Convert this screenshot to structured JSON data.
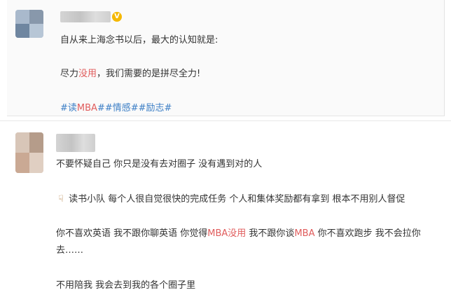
{
  "post": {
    "username_blurred": "",
    "verified_badge": "V",
    "line1": "自从来上海念书以后，最大的认知就是:",
    "line2": {
      "prefix": "尽力",
      "highlight": "没用",
      "suffix": "，我们需要的是拼尽全力!"
    },
    "tags": {
      "t1_prefix": "#读",
      "t1_highlight": "MBA",
      "t1_suffix": "#",
      "t2": "#情感#",
      "t3": "#励志#"
    }
  },
  "comment": {
    "username_blurred": "",
    "line1": "不要怀疑自己 你只是没有去对圈子 没有遇到对的人",
    "line2_icon": "pointing-hand-icon",
    "line2": "读书小队 每个人很自觉很快的完成任务 个人和集体奖励都有拿到 根本不用别人督促",
    "line3": {
      "a": "你不喜欢英语 我不跟你聊英语 你觉得",
      "b_highlight": "MBA没用",
      "c": " 我不跟你谈",
      "d_highlight": "MBA",
      "e": " 你不喜欢跑步 我不会拉你"
    },
    "line4": "去……",
    "line5": "不用陪我 我会去到我的各个圈子里"
  },
  "colors": {
    "highlight": "#e05c5c",
    "tag_link": "#3d7fc6",
    "text": "#333333",
    "badge": "#f5b800"
  }
}
